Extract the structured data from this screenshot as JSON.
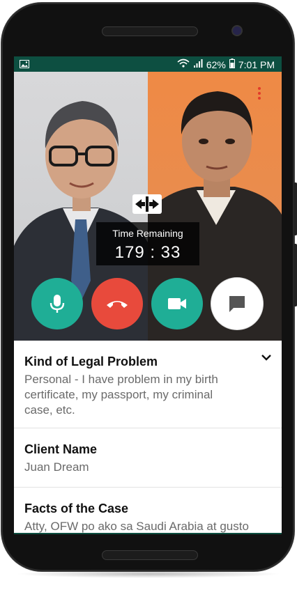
{
  "statusbar": {
    "battery": "62%",
    "time": "7:01 PM",
    "left_icon": "image-icon"
  },
  "call": {
    "timer_label": "Time Remaining",
    "timer_value": "179 : 33",
    "controls": [
      "microphone-icon",
      "end-call-icon",
      "video-camera-icon",
      "chat-icon"
    ],
    "colors": {
      "mic": "#1fae96",
      "end": "#e84a3c",
      "video": "#1fae96",
      "chat": "#ffffff"
    }
  },
  "details": {
    "sections": [
      {
        "title": "Kind of Legal Problem",
        "lines": [
          "Personal - I have problem in my birth",
          "certificate, my passport, my criminal",
          "case, etc."
        ]
      },
      {
        "title": "Client Name",
        "lines": [
          "Juan Dream"
        ]
      },
      {
        "title": "Facts of the Case",
        "lines": [
          "Atty, OFW po ako sa Saudi Arabia at gusto"
        ]
      }
    ]
  }
}
